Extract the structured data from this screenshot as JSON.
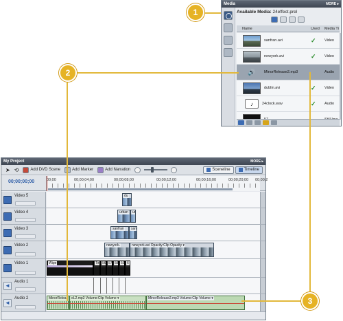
{
  "media_panel": {
    "title": "Media",
    "more": "MORE ▸",
    "available_label": "Available Media:",
    "project_file": "24effect.prel",
    "columns": {
      "name": "Name",
      "used": "Used",
      "type": "Media Ti"
    },
    "items": [
      {
        "name": "sanfran.avi",
        "used": "✓",
        "type": "Video",
        "thumb": "sanfran"
      },
      {
        "name": "newyork.avi",
        "used": "✓",
        "type": "Video",
        "thumb": "newyork"
      },
      {
        "name": "MinorRelease2.mp3",
        "used": "",
        "type": "Audio",
        "thumb": "audio",
        "selected": true
      },
      {
        "name": "dublin.avi",
        "used": "✓",
        "type": "Video",
        "thumb": "dublin"
      },
      {
        "name": "24clock.wav",
        "used": "✓",
        "type": "Audio",
        "thumb": "clock"
      },
      {
        "name": "57",
        "used": "",
        "type": "Still Ima",
        "thumb": "black"
      }
    ]
  },
  "project_panel": {
    "title": "My Project",
    "more": "MORE ▸",
    "toolbar": {
      "add_dvd_scene": "Add DVD Scene",
      "add_marker": "Add Marker",
      "add_narration": "Add Narration",
      "sceneline": "Sceneline",
      "timeline": "Timeline"
    },
    "timecode": "00;00;00;00",
    "ruler_ticks": [
      "00;00",
      "00;00;04;00",
      "00;00;08;00",
      "00;00;12;00",
      "00;00;16;00",
      "00;00;20;00",
      "00;00;2"
    ],
    "tracks": {
      "video5": "Video 5",
      "video4": "Video 4",
      "video3": "Video 3",
      "video2": "Video 2",
      "video1": "Video 1",
      "audio1": "Audio 1",
      "audio2": "Audio 2"
    },
    "clips": {
      "v5": "du",
      "v4": "urban",
      "v4b": "ur",
      "v3": "sanfran",
      "v3b": "san",
      "v2a": "newyork.",
      "v2b": "newyork.avi",
      "v2c": "Opacity:Clip Opacity ▾",
      "v1wipe": "Wipe",
      "v1t": [
        "Tit",
        "56",
        "57",
        "58",
        "59",
        "6"
      ],
      "a2a": "MinorRelea",
      "a2b": "eL2.mp3 Volume:Clip Volume ▾",
      "a2c": "MinorRelease2.mp3 Volume:Clip Volume ▾"
    }
  },
  "callouts": [
    "1",
    "2",
    "3"
  ],
  "colors": {
    "callout": "#e6b325",
    "accent": "#3d6cb3",
    "check": "#2c8c2c"
  }
}
